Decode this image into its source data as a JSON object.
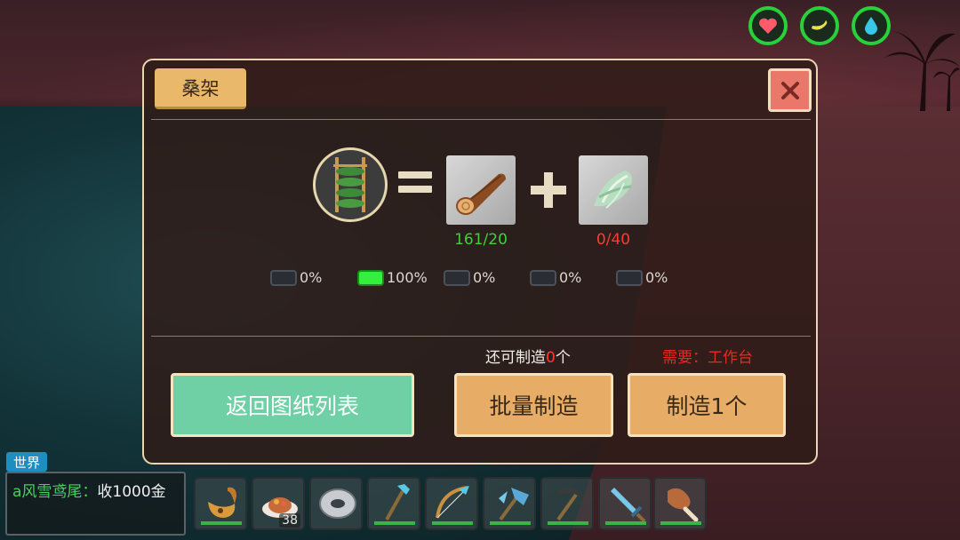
{
  "status_icons": [
    {
      "name": "health",
      "icon": "heart-icon",
      "color": "#ff5a6a"
    },
    {
      "name": "hunger",
      "icon": "banana-icon",
      "color": "#e8e050"
    },
    {
      "name": "thirst",
      "icon": "water-drop-icon",
      "color": "#3ac8e8"
    }
  ],
  "dialog": {
    "title": "桑架",
    "recipe": {
      "result_icon": "mulberry-rack-icon",
      "ingredients": [
        {
          "icon": "wood-log-icon",
          "count_text": "161/20",
          "count_color": "#3fcf3a"
        },
        {
          "icon": "silk-icon",
          "count_text": "0/40",
          "count_color": "#ff3b30"
        }
      ]
    },
    "chances": [
      "0%",
      "100%",
      "0%",
      "0%",
      "0%"
    ],
    "chance_active_index": 1,
    "remaining": {
      "prefix": "还可制造",
      "value": "0",
      "suffix": "个"
    },
    "requirement": "需要：工作台",
    "buttons": {
      "back": "返回图纸列表",
      "batch": "批量制造",
      "craft_one": "制造1个"
    }
  },
  "chat": {
    "channel": "世界",
    "sender": "a风雪鸢尾",
    "separator": "：",
    "message": "收1000金"
  },
  "hotbar": [
    {
      "icon": "bag-icon"
    },
    {
      "icon": "food-plate-icon",
      "qty": "38"
    },
    {
      "icon": "shield-disc-icon"
    },
    {
      "icon": "ice-staff-icon"
    },
    {
      "icon": "ice-bow-icon"
    },
    {
      "icon": "ice-axe-icon"
    },
    {
      "icon": "pickaxe-icon"
    },
    {
      "icon": "ice-sword-icon"
    },
    {
      "icon": "meat-drumstick-icon"
    }
  ]
}
